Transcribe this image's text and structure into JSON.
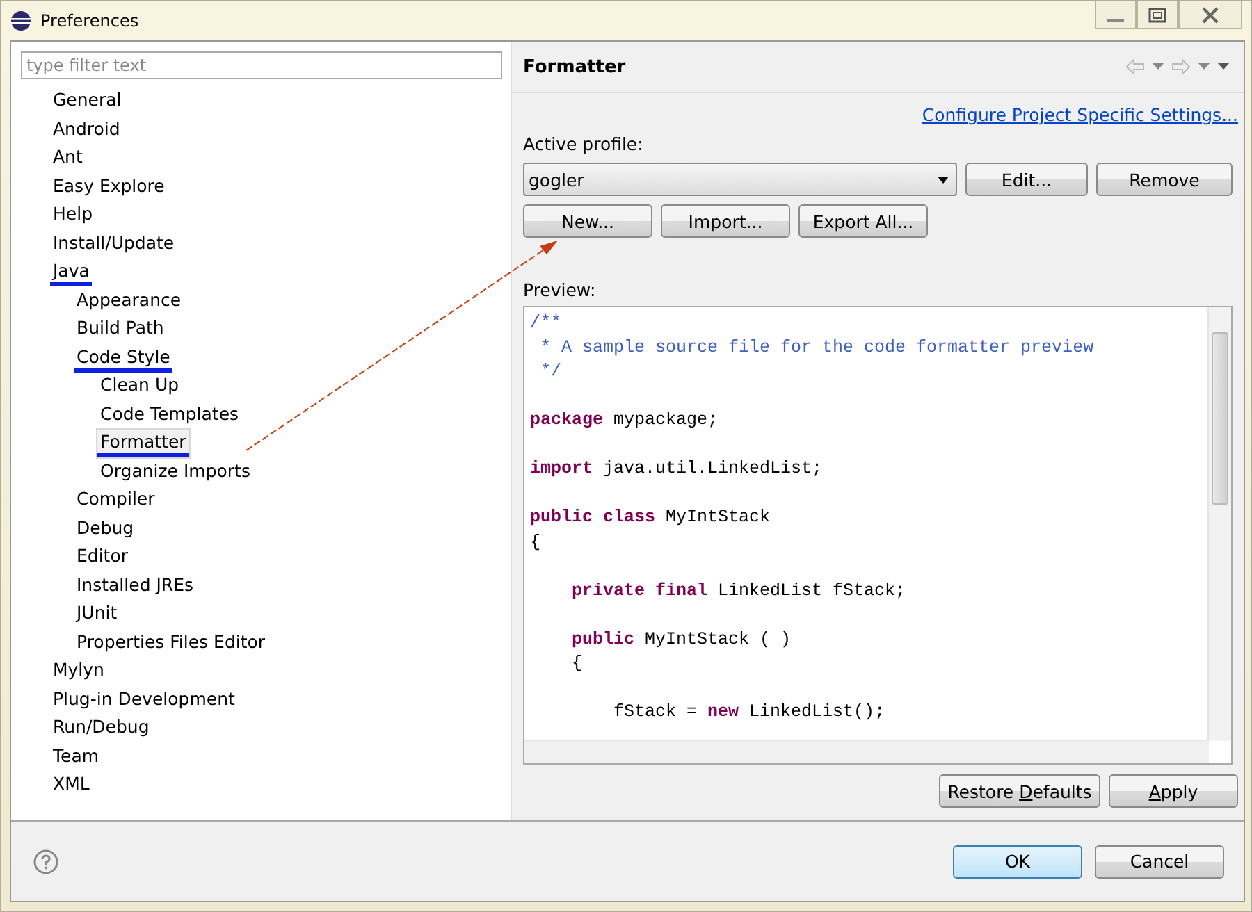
{
  "window": {
    "title": "Preferences"
  },
  "filter": {
    "placeholder": "type filter text"
  },
  "tree": [
    {
      "label": "General",
      "selected": false,
      "marked": false
    },
    {
      "label": "Android",
      "selected": false,
      "marked": false
    },
    {
      "label": "Ant",
      "selected": false,
      "marked": false
    },
    {
      "label": "Easy Explore",
      "selected": false,
      "marked": false
    },
    {
      "label": "Help",
      "selected": false,
      "marked": false
    },
    {
      "label": "Install/Update",
      "selected": false,
      "marked": false
    },
    {
      "label": "Java",
      "selected": false,
      "marked": true,
      "children": [
        {
          "label": "Appearance",
          "selected": false,
          "marked": false
        },
        {
          "label": "Build Path",
          "selected": false,
          "marked": false
        },
        {
          "label": "Code Style",
          "selected": false,
          "marked": true,
          "children": [
            {
              "label": "Clean Up",
              "selected": false,
              "marked": false
            },
            {
              "label": "Code Templates",
              "selected": false,
              "marked": false
            },
            {
              "label": "Formatter",
              "selected": true,
              "marked": true
            },
            {
              "label": "Organize Imports",
              "selected": false,
              "marked": false
            }
          ]
        },
        {
          "label": "Compiler",
          "selected": false,
          "marked": false
        },
        {
          "label": "Debug",
          "selected": false,
          "marked": false
        },
        {
          "label": "Editor",
          "selected": false,
          "marked": false
        },
        {
          "label": "Installed JREs",
          "selected": false,
          "marked": false
        },
        {
          "label": "JUnit",
          "selected": false,
          "marked": false
        },
        {
          "label": "Properties Files Editor",
          "selected": false,
          "marked": false
        }
      ]
    },
    {
      "label": "Mylyn",
      "selected": false,
      "marked": false
    },
    {
      "label": "Plug-in Development",
      "selected": false,
      "marked": false
    },
    {
      "label": "Run/Debug",
      "selected": false,
      "marked": false
    },
    {
      "label": "Team",
      "selected": false,
      "marked": false
    },
    {
      "label": "XML",
      "selected": false,
      "marked": false
    }
  ],
  "page": {
    "title": "Formatter",
    "link": "Configure Project Specific Settings...",
    "profile_label": "Active profile:",
    "profile_value": "gogler",
    "profile_buttons": [
      "Edit...",
      "Remove"
    ],
    "buttons": [
      "New...",
      "Import...",
      "Export All..."
    ],
    "preview_label": "Preview:"
  },
  "preview_lines": [
    {
      "kind": "code",
      "tokens": [
        {
          "kind": "comment",
          "text": "/**"
        }
      ]
    },
    {
      "kind": "code",
      "tokens": [
        {
          "kind": "comment",
          "text": " * A sample source file for the code formatter preview"
        }
      ]
    },
    {
      "kind": "code",
      "tokens": [
        {
          "kind": "comment",
          "text": " */"
        }
      ]
    },
    {
      "kind": "blank"
    },
    {
      "kind": "code",
      "tokens": [
        {
          "kind": "keyword",
          "text": "package"
        },
        {
          "kind": "plain",
          "text": " mypackage;"
        }
      ]
    },
    {
      "kind": "blank"
    },
    {
      "kind": "code",
      "tokens": [
        {
          "kind": "keyword",
          "text": "import"
        },
        {
          "kind": "plain",
          "text": " java.util.LinkedList;"
        }
      ]
    },
    {
      "kind": "blank"
    },
    {
      "kind": "code",
      "tokens": [
        {
          "kind": "keyword",
          "text": "public class"
        },
        {
          "kind": "plain",
          "text": " MyIntStack"
        }
      ]
    },
    {
      "kind": "code",
      "tokens": [
        {
          "kind": "plain",
          "text": "{"
        }
      ]
    },
    {
      "kind": "blank"
    },
    {
      "kind": "code",
      "tokens": [
        {
          "kind": "keyword",
          "text": "    private final"
        },
        {
          "kind": "plain",
          "text": " LinkedList fStack;"
        }
      ]
    },
    {
      "kind": "blank"
    },
    {
      "kind": "code",
      "tokens": [
        {
          "kind": "keyword",
          "text": "    public"
        },
        {
          "kind": "plain",
          "text": " MyIntStack ( )"
        }
      ]
    },
    {
      "kind": "code",
      "tokens": [
        {
          "kind": "plain",
          "text": "    {"
        }
      ]
    },
    {
      "kind": "blank"
    },
    {
      "kind": "code",
      "tokens": [
        {
          "kind": "plain",
          "text": "        fStack = "
        },
        {
          "kind": "keyword",
          "text": "new"
        },
        {
          "kind": "plain",
          "text": " LinkedList();"
        }
      ]
    }
  ],
  "page_buttons": [
    [
      {
        "text": "Restore "
      },
      {
        "text": "D",
        "underlined": true
      },
      {
        "text": "efaults"
      }
    ],
    [
      {
        "text": "A",
        "underlined": true
      },
      {
        "text": "pply"
      }
    ]
  ],
  "dialog_buttons": [
    {
      "label": "OK",
      "default": true
    },
    {
      "label": "Cancel",
      "default": false
    }
  ]
}
